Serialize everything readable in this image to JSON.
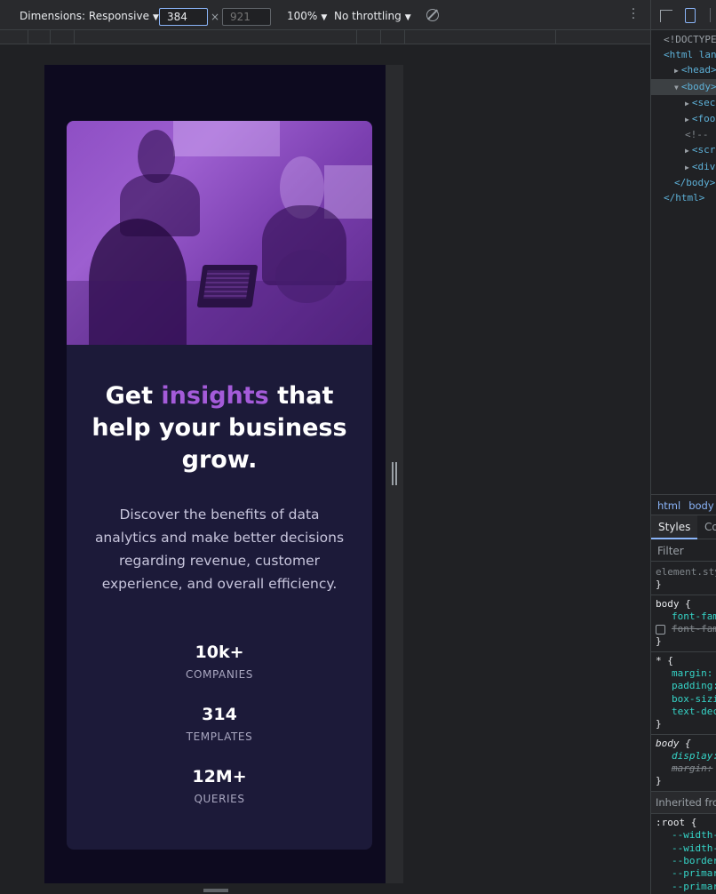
{
  "toolbar": {
    "dimensions_label": "Dimensions: Responsive",
    "width_value": "384",
    "height_placeholder": "921",
    "times": "×",
    "zoom": "100%",
    "throttling": "No throttling"
  },
  "card": {
    "headline_start": "Get ",
    "headline_accent": "insights",
    "headline_end": " that help your business grow.",
    "description": "Discover the benefits of data analytics and make better decisions regarding revenue, customer experience, and overall efficiency.",
    "stats": [
      {
        "number": "10k+",
        "label": "COMPANIES"
      },
      {
        "number": "314",
        "label": "TEMPLATES"
      },
      {
        "number": "12M+",
        "label": "QUERIES"
      }
    ]
  },
  "devtools": {
    "elements": {
      "doctype": "<!DOCTYPE",
      "html_open": "<html lan",
      "head": "<head>…",
      "body": "<body>",
      "section": "<sectio",
      "footer": "<foote",
      "comment": "<!-- ",
      "script": "<scrip",
      "div": "<div i",
      "body_close": "</body>",
      "html_close": "</html>"
    },
    "breadcrumb": [
      "html",
      "body"
    ],
    "tabs": [
      "Styles",
      "Co"
    ],
    "filter_placeholder": "Filter",
    "styles": {
      "element_style": "element.sty",
      "close": "}",
      "body_selector": "body {",
      "font_family": "font-fam",
      "font_family_struck": "font-fam",
      "universal_selector": "* {",
      "margin": "margin:",
      "padding": "padding:",
      "box_sizing": "box-sizi",
      "text_decoration": "text-dec",
      "body_ua_selector": "body {",
      "display": "display:",
      "margin_struck": "margin:",
      "inherited_label": "Inherited fro",
      "root_selector": ":root {",
      "vars": [
        "--width-",
        "--width-",
        "--border",
        "--primar",
        "--primar"
      ]
    }
  }
}
